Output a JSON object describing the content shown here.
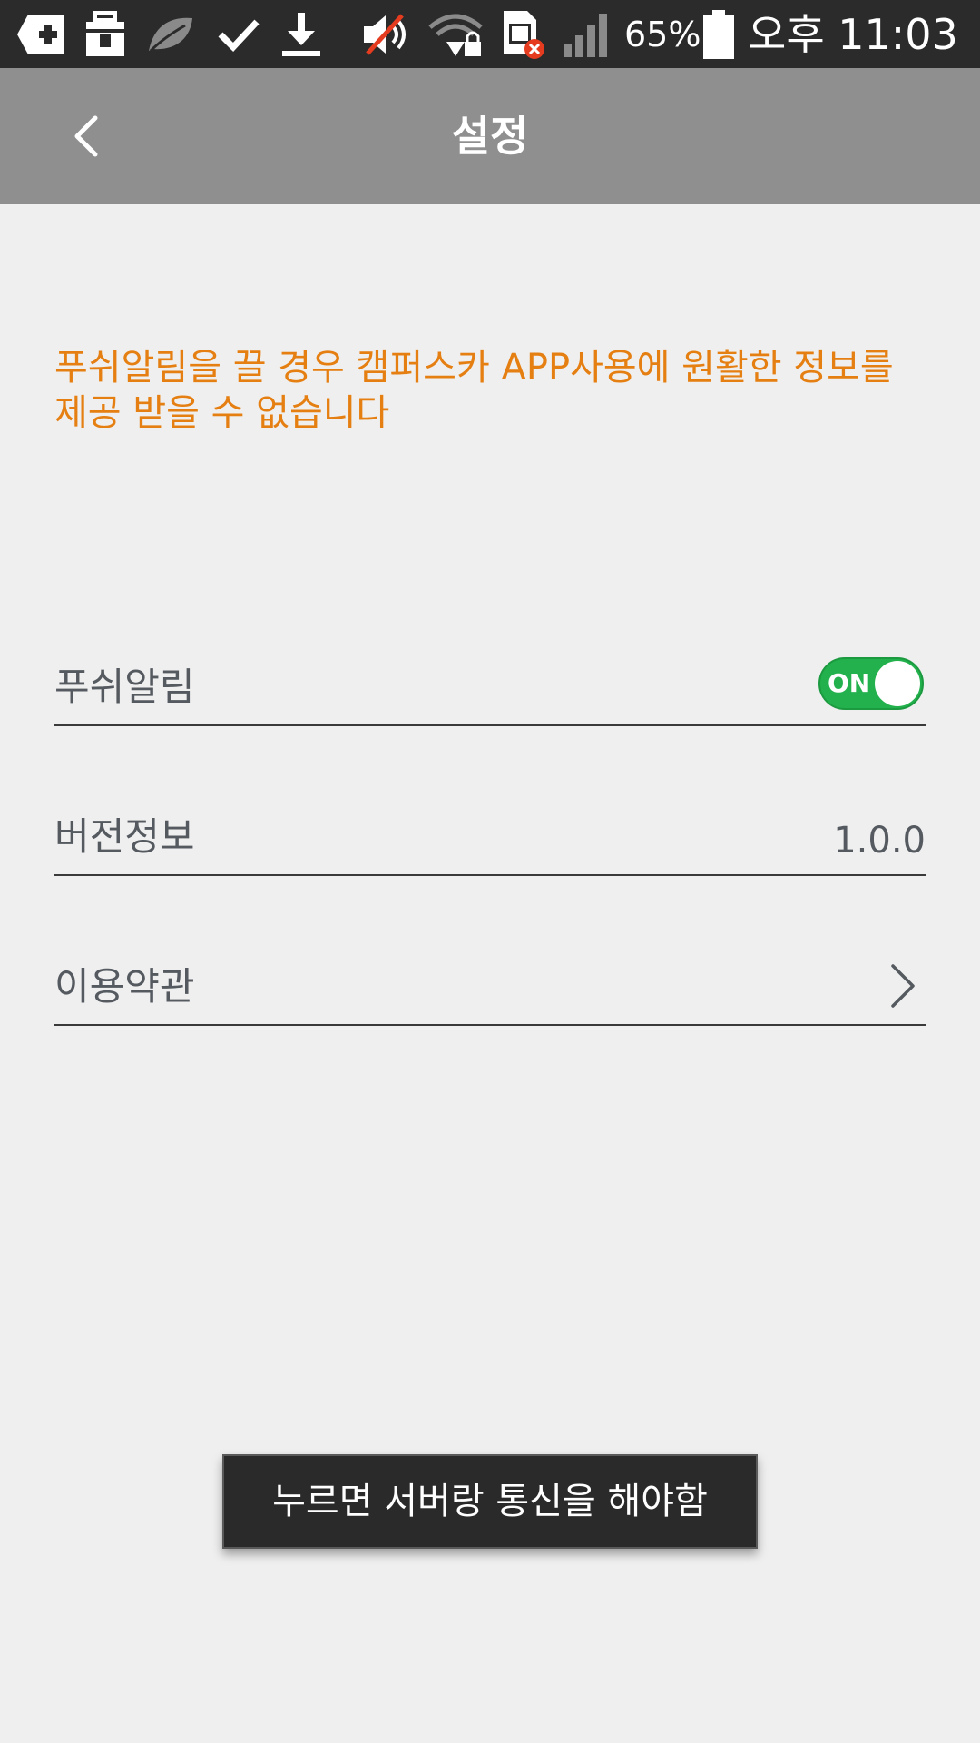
{
  "status_bar": {
    "icons": [
      "medical-plus-icon",
      "briefcase-icon",
      "leaf-icon",
      "check-icon",
      "download-icon",
      "mute-icon",
      "wifi-lock-icon",
      "sim-error-icon",
      "signal-icon",
      "battery-icon"
    ],
    "battery_percent": "65%",
    "time": "오후 11:03"
  },
  "header": {
    "title": "설정"
  },
  "notice": {
    "text": "푸쉬알림을 끌 경우 캠퍼스카 APP사용에 원활한 정보를 제공 받을 수 없습니다"
  },
  "settings": {
    "push": {
      "label": "푸쉬알림",
      "toggle_state": "ON"
    },
    "version": {
      "label": "버전정보",
      "value": "1.0.0"
    },
    "terms": {
      "label": "이용약관"
    }
  },
  "toast": {
    "text": "누르면 서버랑 통신을 해야함"
  },
  "colors": {
    "header_bg": "#8f8f8f",
    "accent_orange": "#e57f12",
    "toggle_on": "#22b14c",
    "status_bar_bg": "#2b2b2b"
  }
}
